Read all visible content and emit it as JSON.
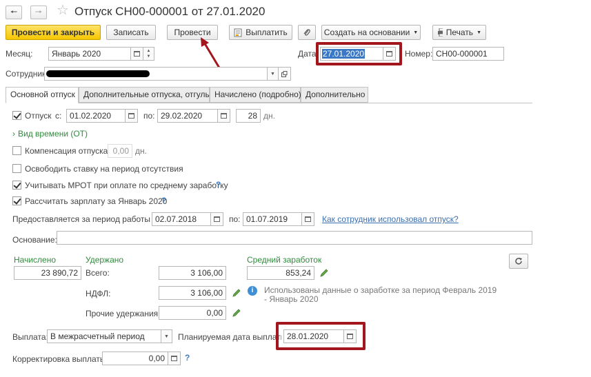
{
  "window": {
    "title": "Отпуск СН00-000001 от 27.01.2020",
    "back_icon": "arrow-left-icon",
    "forward_icon": "arrow-right-icon",
    "favorite_icon": "star-icon"
  },
  "toolbar": {
    "post_close": "Провести и закрыть",
    "save": "Записать",
    "post": "Провести",
    "pay": "Выплатить",
    "create_based": "Создать на основании",
    "print": "Печать"
  },
  "header": {
    "month_label": "Месяц:",
    "month_value": "Январь 2020",
    "date_label": "Дата:",
    "date_value": "27.01.2020",
    "number_label": "Номер:",
    "number_value": "СН00-000001",
    "employee_label": "Сотрудник:"
  },
  "tabs": [
    {
      "label": "Основной отпуск"
    },
    {
      "label": "Дополнительные отпуска, отгулы"
    },
    {
      "label": "Начислено (подробно)"
    },
    {
      "label": "Дополнительно"
    }
  ],
  "vacation": {
    "label": "Отпуск",
    "from_label": "с:",
    "from": "01.02.2020",
    "to_label": "по:",
    "to": "29.02.2020",
    "days": "28",
    "days_unit": "дн.",
    "time_kind": "Вид времени (ОТ)"
  },
  "options": {
    "compensation_label": "Компенсация отпуска",
    "compensation_value": "0,00",
    "compensation_unit": "дн.",
    "free_rate": "Освободить ставку на период отсутствия",
    "mrot": "Учитывать МРОТ при оплате по среднему заработку",
    "calc_salary": "Рассчитать зарплату за Январь 2020",
    "help": "?"
  },
  "work_period": {
    "label": "Предоставляется за период работы с:",
    "from": "02.07.2018",
    "to_label": "по:",
    "to": "01.07.2019",
    "link": "Как сотрудник использовал отпуск?"
  },
  "basis_label": "Основание:",
  "totals": {
    "accrued_label": "Начислено",
    "accrued_value": "23 890,72",
    "withheld_label": "Удержано",
    "total_label": "Всего:",
    "total_value": "3 106,00",
    "ndfl_label": "НДФЛ:",
    "ndfl_value": "3 106,00",
    "other_label": "Прочие удержания:",
    "other_value": "0,00",
    "avg_label": "Средний заработок",
    "avg_value": "853,24",
    "info": "Использованы данные о заработке за период Февраль 2019 - Январь 2020"
  },
  "payment": {
    "label": "Выплата:",
    "value": "В межрасчетный период",
    "planned_label": "Планируемая дата выплаты:",
    "planned_date": "28.01.2020",
    "correction_label": "Корректировка выплаты:",
    "correction_value": "0,00"
  }
}
